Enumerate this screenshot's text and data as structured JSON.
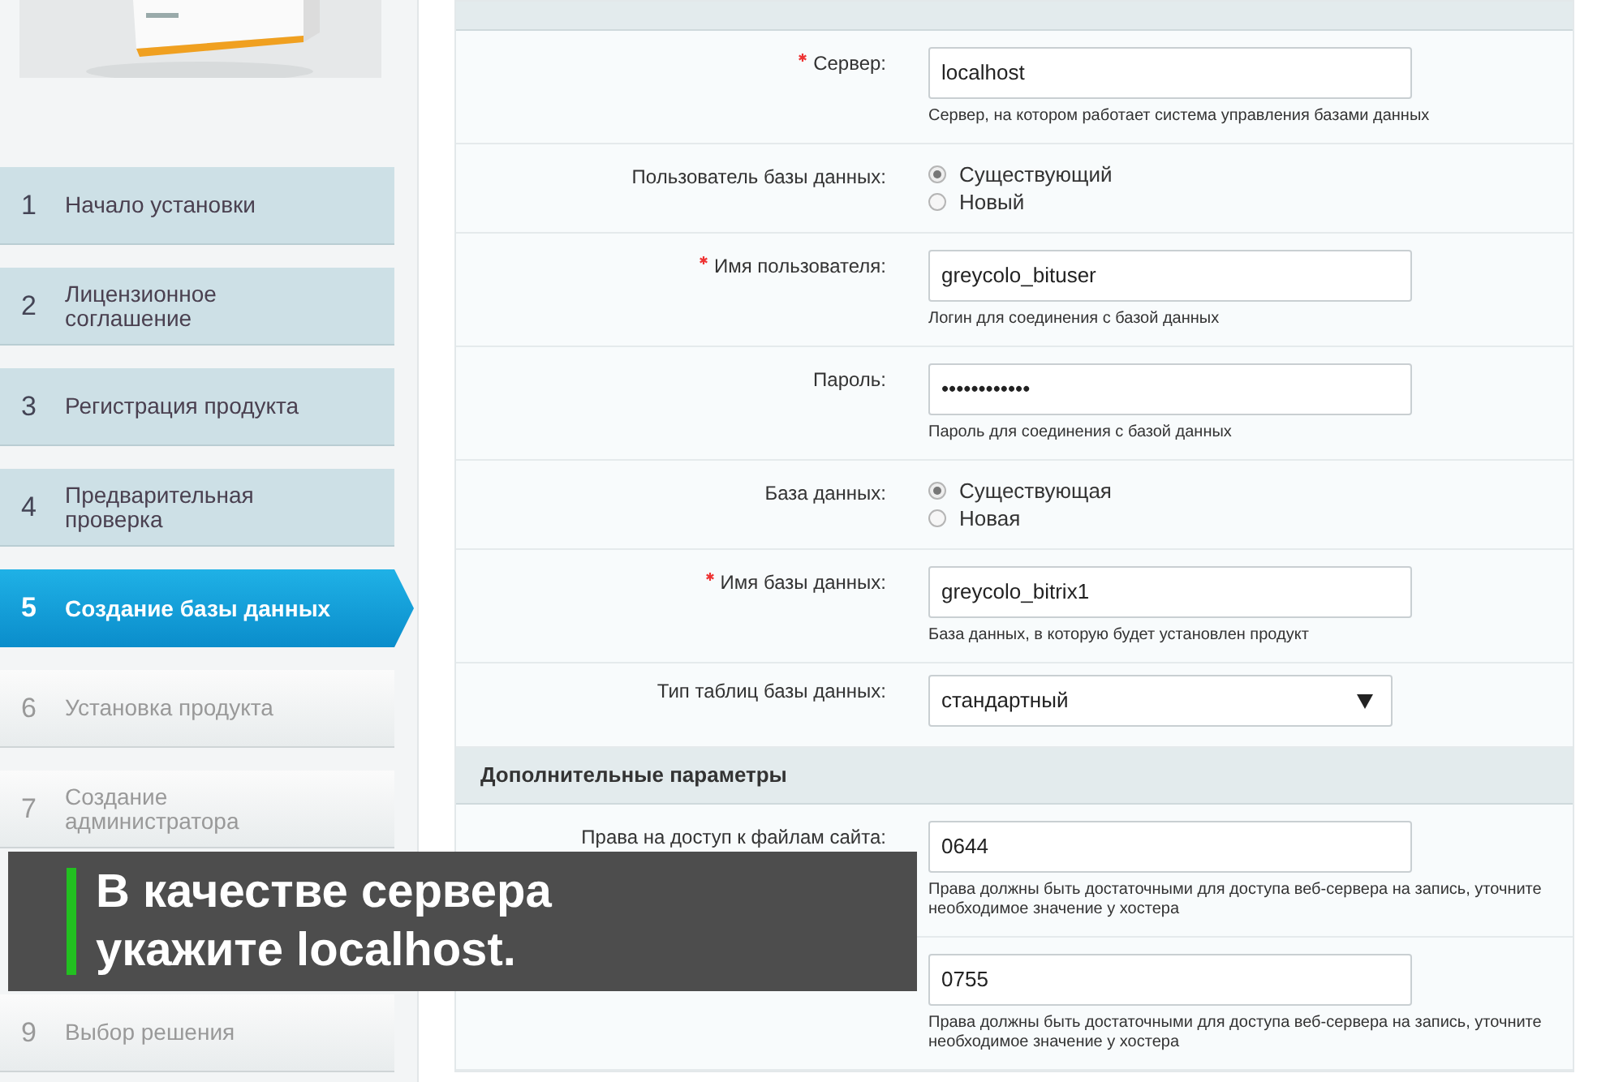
{
  "sidebar": {
    "steps": [
      {
        "number": "1",
        "label": "Начало установки",
        "completed": true,
        "selected": false
      },
      {
        "number": "2",
        "label": "Лицензионное соглашение",
        "completed": true,
        "selected": false
      },
      {
        "number": "3",
        "label": "Регистрация продукта",
        "completed": true,
        "selected": false
      },
      {
        "number": "4",
        "label": "Предварительная проверка",
        "completed": true,
        "selected": false
      },
      {
        "number": "5",
        "label": "Создание базы данных",
        "completed": false,
        "selected": true
      },
      {
        "number": "6",
        "label": "Установка продукта",
        "completed": false,
        "selected": false
      },
      {
        "number": "7",
        "label": "Создание администратора",
        "completed": false,
        "selected": false
      },
      {
        "number": "9",
        "label": "Выбор решения",
        "completed": false,
        "selected": false
      }
    ]
  },
  "form": {
    "sections": [
      {
        "rows": [
          {
            "kind": "text",
            "required": true,
            "label": "Сервер:",
            "value": "localhost",
            "hint": "Сервер, на котором работает система управления базами данных"
          },
          {
            "kind": "radio",
            "required": false,
            "label": "Пользователь базы данных:",
            "options": [
              {
                "label": "Существующий",
                "selected": true
              },
              {
                "label": "Новый",
                "selected": false
              }
            ]
          },
          {
            "kind": "text",
            "required": true,
            "label": "Имя пользователя:",
            "value": "greycolo_bituser",
            "hint": "Логин для соединения с базой данных"
          },
          {
            "kind": "password",
            "required": false,
            "label": "Пароль:",
            "value": "••••••••••••",
            "hint": "Пароль для соединения с базой данных"
          },
          {
            "kind": "radio",
            "required": false,
            "label": "База данных:",
            "options": [
              {
                "label": "Существующая",
                "selected": true
              },
              {
                "label": "Новая",
                "selected": false
              }
            ]
          },
          {
            "kind": "text",
            "required": true,
            "label": "Имя базы данных:",
            "value": "greycolo_bitrix1",
            "hint": "База данных, в которую будет установлен продукт"
          },
          {
            "kind": "select",
            "required": false,
            "label": "Тип таблиц базы данных:",
            "value": "стандартный"
          }
        ]
      },
      {
        "title": "Дополнительные параметры",
        "rows": [
          {
            "kind": "text",
            "required": false,
            "label": "Права на доступ к файлам сайта:",
            "value": "0644",
            "hint": "Права должны быть достаточными для доступа веб-сервера на запись, уточните необходимое значение у хостера"
          },
          {
            "kind": "text",
            "required": false,
            "value": "0755",
            "hint": "Права должны быть достаточными для доступа веб-сервера на запись, уточните необходимое значение у хостера"
          }
        ]
      }
    ]
  },
  "caption": "В качестве сервера укажите localhost."
}
